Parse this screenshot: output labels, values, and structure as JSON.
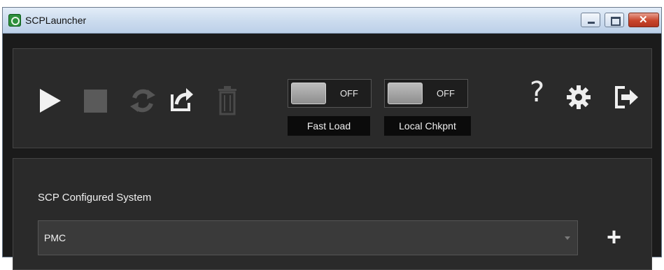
{
  "window": {
    "title": "SCPLauncher",
    "minimize_icon": "minimize-icon",
    "maximize_icon": "maximize-icon",
    "close_icon": "close-icon",
    "close_glyph": "✕"
  },
  "toolbar": {
    "icons": [
      "play-icon",
      "stop-icon",
      "refresh-icon",
      "share-icon",
      "trash-icon",
      "help-icon",
      "gear-icon",
      "exit-icon"
    ],
    "help_glyph": "?",
    "fast_load": {
      "label": "Fast Load",
      "state": "OFF"
    },
    "local_chkpnt": {
      "label": "Local Chkpnt",
      "state": "OFF"
    }
  },
  "config": {
    "label": "SCP Configured System",
    "selected": "PMC",
    "add_glyph": "+"
  },
  "colors": {
    "background": "#1b1b1b",
    "panel": "#2a2a2a",
    "titlebar": "#cbdbee",
    "close": "#c8452c"
  }
}
